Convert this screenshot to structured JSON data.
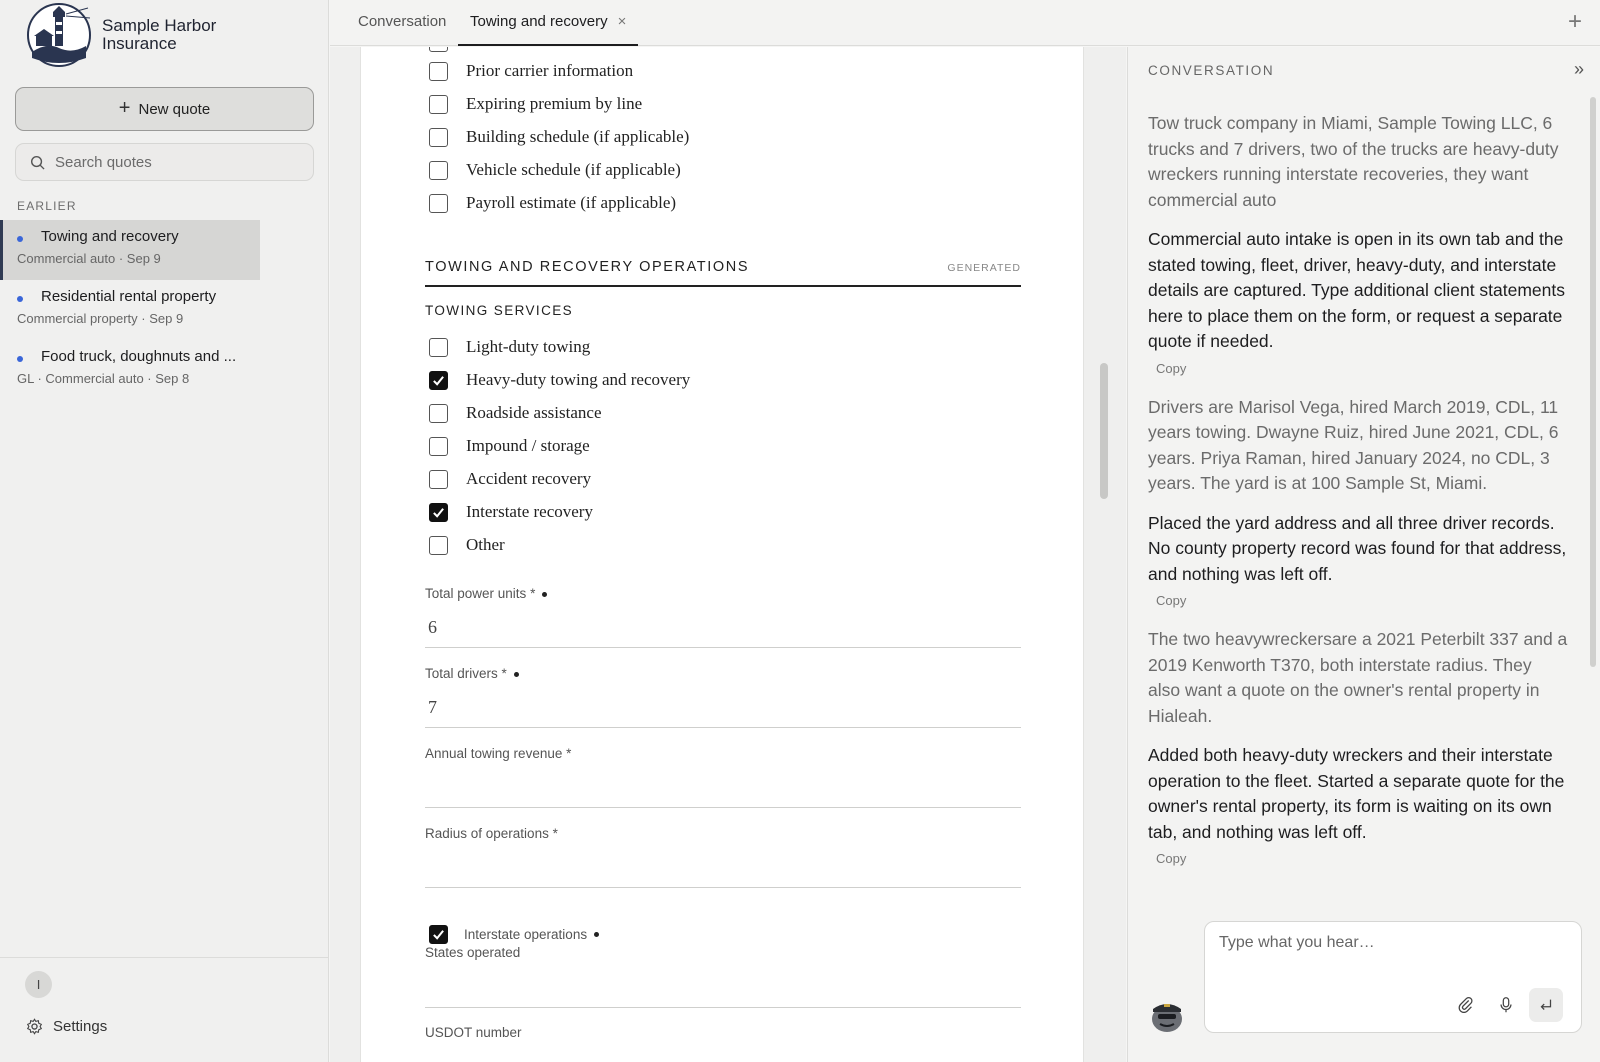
{
  "brand": {
    "name": "Sample Harbor Insurance"
  },
  "sidebar": {
    "new_quote_label": "New quote",
    "search_placeholder": "Search quotes",
    "section_label": "EARLIER",
    "quotes": [
      {
        "name": "Towing and recovery",
        "meta": "Commercial auto · Sep 9",
        "active": true
      },
      {
        "name": "Residential rental property",
        "meta": "Commercial property · Sep 9",
        "active": false
      },
      {
        "name": "Food truck, doughnuts and ...",
        "meta": "GL · Commercial auto · Sep 8",
        "active": false
      }
    ],
    "user_initial": "I",
    "settings_label": "Settings"
  },
  "tabs": [
    {
      "label": "Conversation",
      "active": false
    },
    {
      "label": "Towing and recovery",
      "active": true,
      "close": "×"
    }
  ],
  "tab_add": "+",
  "form": {
    "prior_items": [
      {
        "label": "Prior carrier information",
        "checked": false
      },
      {
        "label": "Expiring premium by line",
        "checked": false
      },
      {
        "label": "Building schedule (if applicable)",
        "checked": false
      },
      {
        "label": "Vehicle schedule (if applicable)",
        "checked": false
      },
      {
        "label": "Payroll estimate (if applicable)",
        "checked": false
      }
    ],
    "section_title": "TOWING AND RECOVERY OPERATIONS",
    "section_badge": "GENERATED",
    "sub_title": "TOWING SERVICES",
    "services": [
      {
        "label": "Light-duty towing",
        "checked": false
      },
      {
        "label": "Heavy-duty towing and recovery",
        "checked": true
      },
      {
        "label": "Roadside assistance",
        "checked": false
      },
      {
        "label": "Impound / storage",
        "checked": false
      },
      {
        "label": "Accident recovery",
        "checked": false
      },
      {
        "label": "Interstate recovery",
        "checked": true
      },
      {
        "label": "Other",
        "checked": false
      }
    ],
    "fields": {
      "power_units": {
        "label": "Total power units",
        "req": "*",
        "value": "6"
      },
      "drivers": {
        "label": "Total drivers",
        "req": "*",
        "value": "7"
      },
      "revenue": {
        "label": "Annual towing revenue",
        "req": "*",
        "value": ""
      },
      "radius": {
        "label": "Radius of operations",
        "req": "*",
        "value": ""
      },
      "interstate": {
        "label": "Interstate operations",
        "checked": true
      },
      "states": {
        "label": "States operated",
        "value": ""
      },
      "usdot": {
        "label": "USDOT number"
      }
    }
  },
  "conversation": {
    "header": "CONVERSATION",
    "copy_label": "Copy",
    "messages": [
      {
        "role": "user",
        "text": "Tow truck company in Miami, Sample Towing LLC, 6 trucks and 7 drivers, two of the trucks are heavy-duty wreckers running interstate recoveries, they want commercial auto"
      },
      {
        "role": "assistant",
        "text": "Commercial auto intake is open in its own tab and the stated towing, fleet, driver, heavy-duty, and interstate details are captured. Type additional client statements here to place them on the form, or request a separate quote if needed."
      },
      {
        "role": "user",
        "text": "Drivers are Marisol Vega, hired March 2019, CDL, 11 years towing. Dwayne Ruiz, hired June 2021, CDL, 6 years. Priya Raman, hired January 2024, no CDL, 3 years. The yard is at 100 Sample St, Miami."
      },
      {
        "role": "assistant",
        "text": "Placed the yard address and all three driver records. No county property record was found for that address, and nothing was left off."
      },
      {
        "role": "user",
        "text": "The two heavywreckersare a 2021 Peterbilt 337 and a 2019 Kenworth T370, both interstate radius. They also want a quote on the owner's rental property in Hialeah."
      },
      {
        "role": "assistant",
        "text": "Added both heavy-duty wreckers and their interstate operation to the fleet. Started a separate quote for the owner's rental property, its form is waiting on its own tab, and nothing was left off."
      }
    ],
    "composer_placeholder": "Type what you hear…"
  }
}
